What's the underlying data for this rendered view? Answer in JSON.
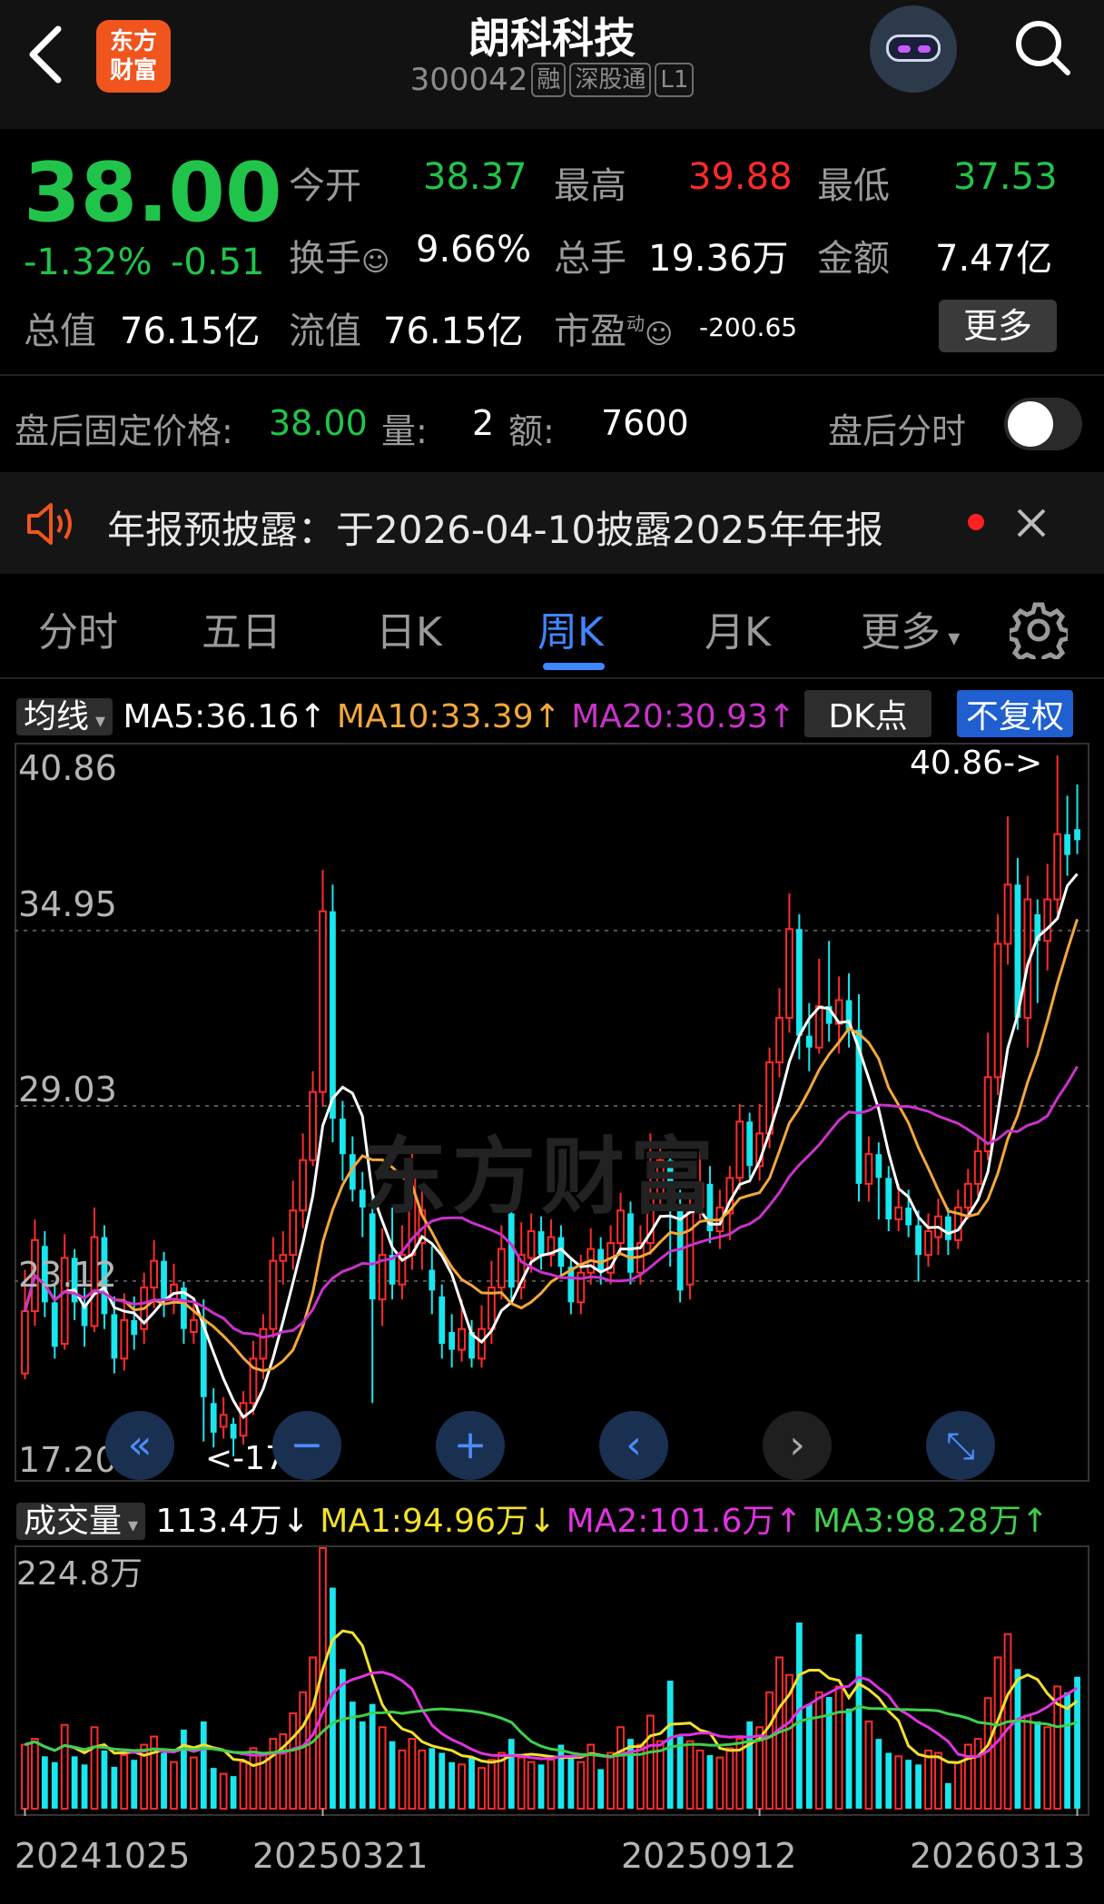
{
  "header": {
    "title": "朗科科技",
    "code": "300042",
    "tags": [
      "融",
      "深股通",
      "L1"
    ],
    "logo_text": [
      "东方",
      "财富"
    ]
  },
  "quote": {
    "price": "38.00",
    "change_pct": "-1.32%",
    "change": "-0.51",
    "open_label": "今开",
    "open": "38.37",
    "high_label": "最高",
    "high": "39.88",
    "low_label": "最低",
    "low": "37.53",
    "turnover_label": "换手",
    "turnover": "9.66%",
    "volume_label": "总手",
    "volume": "19.36万",
    "amount_label": "金额",
    "amount": "7.47亿",
    "mktcap_label": "总值",
    "mktcap": "76.15亿",
    "float_label": "流值",
    "float": "76.15亿",
    "pe_label": "市盈",
    "pe_sup": "动",
    "pe": "-200.65",
    "more": "更多"
  },
  "after_hours": {
    "price_label": "盘后固定价格:",
    "price": "38.00",
    "vol_label": "量:",
    "vol": "2",
    "amt_label": "额:",
    "amt": "7600",
    "intraday_label": "盘后分时"
  },
  "notice": {
    "text": "年报预披露：于2026-04-10披露2025年年报"
  },
  "tabs": [
    "分时",
    "五日",
    "日K",
    "周K",
    "月K",
    "更多"
  ],
  "price_indicators": {
    "dropdown": "均线",
    "ma5": "MA5:36.16",
    "ma10": "MA10:33.39",
    "ma20": "MA20:30.93",
    "dk": "DK点",
    "fq": "不复权"
  },
  "price_axis": [
    "40.86",
    "34.95",
    "29.03",
    "23.12",
    "17.20"
  ],
  "max_label": "40.86->",
  "min_label": "<-17.20",
  "watermark": "东方财富",
  "volume_indicators": {
    "dropdown": "成交量",
    "vol": "113.4万",
    "ma1": "MA1:94.96万",
    "ma2": "MA2:101.6万",
    "ma3": "MA3:98.28万"
  },
  "volume_axis_max": "224.8万",
  "x_dates": [
    "20241025",
    "20250321",
    "20250912",
    "20260313"
  ],
  "colors": {
    "up": "#ff2b2b",
    "down": "#21c44a",
    "accent": "#3f86ff",
    "ma5": "#ffffff",
    "ma10": "#f2a83c",
    "ma20": "#c933c9"
  },
  "chart_data": {
    "type": "candlestick",
    "title": "朗科科技 周K",
    "price_range": [
      17.2,
      40.86
    ],
    "volume_max_wan": 224.8,
    "candles": [
      {
        "o": 20.0,
        "c": 22.1,
        "h": 23.5,
        "l": 19.8,
        "v": 55
      },
      {
        "o": 22.1,
        "c": 24.5,
        "h": 25.2,
        "l": 21.6,
        "v": 60
      },
      {
        "o": 24.3,
        "c": 22.4,
        "h": 24.8,
        "l": 21.9,
        "v": 45
      },
      {
        "o": 22.4,
        "c": 20.9,
        "h": 23.0,
        "l": 20.5,
        "v": 40
      },
      {
        "o": 21.0,
        "c": 23.9,
        "h": 24.7,
        "l": 20.8,
        "v": 72
      },
      {
        "o": 23.9,
        "c": 22.4,
        "h": 24.2,
        "l": 21.8,
        "v": 45
      },
      {
        "o": 22.3,
        "c": 21.6,
        "h": 22.9,
        "l": 20.9,
        "v": 38
      },
      {
        "o": 21.6,
        "c": 24.6,
        "h": 25.6,
        "l": 21.4,
        "v": 70
      },
      {
        "o": 24.6,
        "c": 22.0,
        "h": 25.0,
        "l": 21.5,
        "v": 50
      },
      {
        "o": 22.0,
        "c": 20.5,
        "h": 22.6,
        "l": 20.0,
        "v": 36
      },
      {
        "o": 20.5,
        "c": 21.8,
        "h": 22.7,
        "l": 20.1,
        "v": 46
      },
      {
        "o": 21.8,
        "c": 21.3,
        "h": 22.6,
        "l": 20.8,
        "v": 42
      },
      {
        "o": 21.5,
        "c": 22.9,
        "h": 23.4,
        "l": 21.0,
        "v": 55
      },
      {
        "o": 22.9,
        "c": 23.8,
        "h": 24.5,
        "l": 22.2,
        "v": 62
      },
      {
        "o": 23.8,
        "c": 22.5,
        "h": 24.1,
        "l": 21.9,
        "v": 48
      },
      {
        "o": 22.5,
        "c": 23.0,
        "h": 23.7,
        "l": 22.0,
        "v": 40
      },
      {
        "o": 22.9,
        "c": 21.5,
        "h": 23.1,
        "l": 21.0,
        "v": 68
      },
      {
        "o": 21.4,
        "c": 21.8,
        "h": 22.4,
        "l": 21.0,
        "v": 44
      },
      {
        "o": 21.8,
        "c": 19.2,
        "h": 22.5,
        "l": 17.7,
        "v": 75
      },
      {
        "o": 19.0,
        "c": 18.0,
        "h": 19.5,
        "l": 17.5,
        "v": 35
      },
      {
        "o": 18.2,
        "c": 18.6,
        "h": 19.2,
        "l": 17.8,
        "v": 30
      },
      {
        "o": 18.3,
        "c": 17.8,
        "h": 18.5,
        "l": 17.2,
        "v": 28
      },
      {
        "o": 17.9,
        "c": 19.0,
        "h": 19.4,
        "l": 17.6,
        "v": 40
      },
      {
        "o": 19.0,
        "c": 20.5,
        "h": 21.1,
        "l": 18.6,
        "v": 52
      },
      {
        "o": 20.5,
        "c": 21.5,
        "h": 22.0,
        "l": 19.8,
        "v": 48
      },
      {
        "o": 21.5,
        "c": 23.8,
        "h": 24.6,
        "l": 21.2,
        "v": 60
      },
      {
        "o": 23.8,
        "c": 24.0,
        "h": 24.8,
        "l": 23.0,
        "v": 64
      },
      {
        "o": 24.0,
        "c": 25.5,
        "h": 26.5,
        "l": 23.5,
        "v": 82
      },
      {
        "o": 25.5,
        "c": 27.2,
        "h": 28.1,
        "l": 24.9,
        "v": 100
      },
      {
        "o": 27.2,
        "c": 29.5,
        "h": 30.2,
        "l": 27.0,
        "v": 130
      },
      {
        "o": 29.5,
        "c": 35.6,
        "h": 37.0,
        "l": 29.0,
        "v": 224
      },
      {
        "o": 35.6,
        "c": 28.6,
        "h": 36.5,
        "l": 27.8,
        "v": 190
      },
      {
        "o": 28.6,
        "c": 27.4,
        "h": 29.2,
        "l": 26.5,
        "v": 120
      },
      {
        "o": 27.4,
        "c": 26.2,
        "h": 28.0,
        "l": 25.8,
        "v": 92
      },
      {
        "o": 26.2,
        "c": 25.6,
        "h": 26.8,
        "l": 24.6,
        "v": 75
      },
      {
        "o": 25.4,
        "c": 22.5,
        "h": 26.0,
        "l": 19.0,
        "v": 90
      },
      {
        "o": 22.5,
        "c": 24.0,
        "h": 24.9,
        "l": 21.6,
        "v": 70
      },
      {
        "o": 24.0,
        "c": 23.0,
        "h": 25.6,
        "l": 22.5,
        "v": 58
      },
      {
        "o": 23.0,
        "c": 24.0,
        "h": 25.0,
        "l": 22.5,
        "v": 50
      },
      {
        "o": 24.0,
        "c": 26.6,
        "h": 27.5,
        "l": 23.5,
        "v": 60
      },
      {
        "o": 24.4,
        "c": 25.5,
        "h": 26.2,
        "l": 23.5,
        "v": 50
      },
      {
        "o": 23.5,
        "c": 22.8,
        "h": 24.3,
        "l": 22.0,
        "v": 52
      },
      {
        "o": 22.6,
        "c": 21.0,
        "h": 23.0,
        "l": 20.5,
        "v": 48
      },
      {
        "o": 21.4,
        "c": 20.8,
        "h": 22.0,
        "l": 20.2,
        "v": 40
      },
      {
        "o": 20.8,
        "c": 21.5,
        "h": 22.5,
        "l": 20.4,
        "v": 38
      },
      {
        "o": 21.4,
        "c": 20.5,
        "h": 21.8,
        "l": 20.2,
        "v": 44
      },
      {
        "o": 20.5,
        "c": 21.5,
        "h": 22.3,
        "l": 20.2,
        "v": 35
      },
      {
        "o": 21.5,
        "c": 22.9,
        "h": 23.8,
        "l": 21.0,
        "v": 42
      },
      {
        "o": 22.9,
        "c": 24.2,
        "h": 25.0,
        "l": 22.5,
        "v": 48
      },
      {
        "o": 25.4,
        "c": 22.9,
        "h": 25.7,
        "l": 22.5,
        "v": 60
      },
      {
        "o": 22.9,
        "c": 24.0,
        "h": 25.1,
        "l": 22.5,
        "v": 44
      },
      {
        "o": 23.9,
        "c": 24.8,
        "h": 25.4,
        "l": 23.4,
        "v": 40
      },
      {
        "o": 24.8,
        "c": 24.0,
        "h": 25.3,
        "l": 23.5,
        "v": 38
      },
      {
        "o": 24.0,
        "c": 24.6,
        "h": 25.2,
        "l": 23.6,
        "v": 42
      },
      {
        "o": 24.6,
        "c": 23.6,
        "h": 25.0,
        "l": 23.2,
        "v": 55
      },
      {
        "o": 23.6,
        "c": 22.4,
        "h": 23.9,
        "l": 22.0,
        "v": 46
      },
      {
        "o": 22.4,
        "c": 23.4,
        "h": 24.0,
        "l": 22.0,
        "v": 40
      },
      {
        "o": 23.4,
        "c": 24.2,
        "h": 24.9,
        "l": 23.0,
        "v": 55
      },
      {
        "o": 24.2,
        "c": 23.5,
        "h": 24.6,
        "l": 23.0,
        "v": 34
      },
      {
        "o": 23.4,
        "c": 24.4,
        "h": 25.0,
        "l": 23.0,
        "v": 48
      },
      {
        "o": 24.4,
        "c": 25.5,
        "h": 26.1,
        "l": 24.0,
        "v": 70
      },
      {
        "o": 25.4,
        "c": 23.4,
        "h": 25.8,
        "l": 23.0,
        "v": 60
      },
      {
        "o": 23.4,
        "c": 24.4,
        "h": 25.0,
        "l": 23.0,
        "v": 55
      },
      {
        "o": 24.4,
        "c": 26.0,
        "h": 28.1,
        "l": 24.0,
        "v": 80
      },
      {
        "o": 26.0,
        "c": 27.2,
        "h": 27.8,
        "l": 25.5,
        "v": 58
      },
      {
        "o": 27.2,
        "c": 25.6,
        "h": 27.5,
        "l": 23.6,
        "v": 110
      },
      {
        "o": 25.6,
        "c": 22.8,
        "h": 26.2,
        "l": 22.4,
        "v": 62
      },
      {
        "o": 23.0,
        "c": 25.6,
        "h": 26.0,
        "l": 22.5,
        "v": 58
      },
      {
        "o": 25.6,
        "c": 26.4,
        "h": 27.5,
        "l": 25.2,
        "v": 50
      },
      {
        "o": 26.4,
        "c": 24.8,
        "h": 27.0,
        "l": 24.4,
        "v": 46
      },
      {
        "o": 24.8,
        "c": 25.6,
        "h": 26.2,
        "l": 24.2,
        "v": 44
      },
      {
        "o": 25.4,
        "c": 26.6,
        "h": 27.0,
        "l": 24.5,
        "v": 52
      },
      {
        "o": 26.6,
        "c": 28.5,
        "h": 29.1,
        "l": 26.2,
        "v": 60
      },
      {
        "o": 28.5,
        "c": 27.0,
        "h": 28.8,
        "l": 26.6,
        "v": 75
      },
      {
        "o": 27.0,
        "c": 28.1,
        "h": 29.1,
        "l": 26.5,
        "v": 70
      },
      {
        "o": 28.1,
        "c": 30.5,
        "h": 31.0,
        "l": 27.6,
        "v": 100
      },
      {
        "o": 30.5,
        "c": 32.0,
        "h": 33.0,
        "l": 30.0,
        "v": 130
      },
      {
        "o": 32.0,
        "c": 35.0,
        "h": 36.2,
        "l": 31.5,
        "v": 115
      },
      {
        "o": 35.0,
        "c": 31.4,
        "h": 35.5,
        "l": 30.6,
        "v": 160
      },
      {
        "o": 31.4,
        "c": 31.0,
        "h": 32.5,
        "l": 30.2,
        "v": 90
      },
      {
        "o": 31.0,
        "c": 32.4,
        "h": 34.0,
        "l": 30.8,
        "v": 100
      },
      {
        "o": 32.4,
        "c": 31.8,
        "h": 34.6,
        "l": 31.2,
        "v": 96
      },
      {
        "o": 31.8,
        "c": 32.6,
        "h": 33.4,
        "l": 30.8,
        "v": 105
      },
      {
        "o": 32.6,
        "c": 31.6,
        "h": 33.5,
        "l": 31.0,
        "v": 86
      },
      {
        "o": 31.6,
        "c": 26.4,
        "h": 32.8,
        "l": 25.8,
        "v": 150
      },
      {
        "o": 26.4,
        "c": 27.4,
        "h": 28.0,
        "l": 25.8,
        "v": 75
      },
      {
        "o": 27.4,
        "c": 26.6,
        "h": 27.8,
        "l": 25.2,
        "v": 60
      },
      {
        "o": 26.6,
        "c": 25.2,
        "h": 27.0,
        "l": 24.8,
        "v": 48
      },
      {
        "o": 25.2,
        "c": 25.6,
        "h": 26.4,
        "l": 24.8,
        "v": 45
      },
      {
        "o": 25.6,
        "c": 25.0,
        "h": 26.2,
        "l": 24.6,
        "v": 42
      },
      {
        "o": 25.0,
        "c": 24.0,
        "h": 25.5,
        "l": 23.1,
        "v": 38
      },
      {
        "o": 24.0,
        "c": 24.8,
        "h": 25.4,
        "l": 23.6,
        "v": 50
      },
      {
        "o": 24.6,
        "c": 25.3,
        "h": 25.9,
        "l": 24.0,
        "v": 48
      },
      {
        "o": 25.3,
        "c": 24.5,
        "h": 25.6,
        "l": 24.0,
        "v": 22
      },
      {
        "o": 24.5,
        "c": 25.6,
        "h": 26.2,
        "l": 24.2,
        "v": 40
      },
      {
        "o": 25.6,
        "c": 26.4,
        "h": 26.9,
        "l": 25.2,
        "v": 55
      },
      {
        "o": 26.4,
        "c": 27.5,
        "h": 28.0,
        "l": 26.0,
        "v": 60
      },
      {
        "o": 27.5,
        "c": 30.0,
        "h": 31.5,
        "l": 27.2,
        "v": 95
      },
      {
        "o": 30.0,
        "c": 34.5,
        "h": 35.5,
        "l": 29.4,
        "v": 130
      },
      {
        "o": 34.5,
        "c": 36.5,
        "h": 38.8,
        "l": 33.8,
        "v": 150
      },
      {
        "o": 36.5,
        "c": 32.0,
        "h": 37.4,
        "l": 31.6,
        "v": 120
      },
      {
        "o": 32.0,
        "c": 36.0,
        "h": 36.8,
        "l": 31.0,
        "v": 80
      },
      {
        "o": 35.5,
        "c": 34.6,
        "h": 36.0,
        "l": 32.5,
        "v": 75
      },
      {
        "o": 34.6,
        "c": 36.0,
        "h": 37.2,
        "l": 33.6,
        "v": 70
      },
      {
        "o": 36.0,
        "c": 38.2,
        "h": 40.86,
        "l": 35.5,
        "v": 105
      },
      {
        "o": 38.2,
        "c": 37.5,
        "h": 39.5,
        "l": 36.8,
        "v": 100
      },
      {
        "o": 38.37,
        "c": 38.0,
        "h": 39.88,
        "l": 37.53,
        "v": 113.4
      }
    ]
  }
}
